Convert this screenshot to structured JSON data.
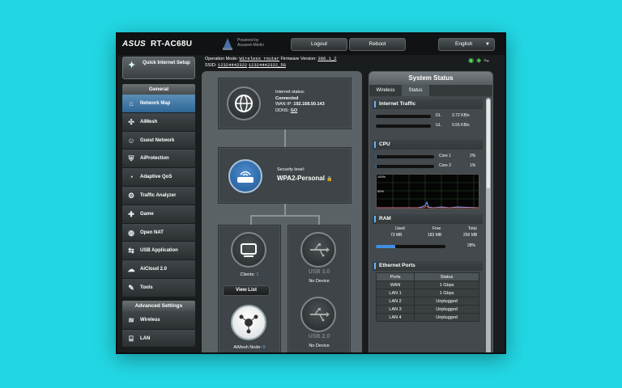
{
  "header": {
    "brand": "ASUS",
    "model": "RT-AC68U",
    "powered_by": "Powered by",
    "powered_name": "Asuswrt-Merlin",
    "logout": "Logout",
    "reboot": "Reboot",
    "language": "English"
  },
  "info": {
    "op_mode_label": "Operation Mode:",
    "op_mode_value": "Wireless router",
    "firmware_label": "Firmware Version:",
    "firmware_value": "386.1_2",
    "ssid_label": "SSID:",
    "ssid_1": "12324442322",
    "ssid_2": "12324442322_5G"
  },
  "sidebar": {
    "qis": "Quick Internet Setup",
    "general": "General",
    "items": [
      {
        "label": "Network Map",
        "icon": "network-map-icon"
      },
      {
        "label": "AiMesh",
        "icon": "aimesh-icon"
      },
      {
        "label": "Guest Network",
        "icon": "guest-network-icon"
      },
      {
        "label": "AiProtection",
        "icon": "aiprotection-icon"
      },
      {
        "label": "Adaptive QoS",
        "icon": "qos-icon"
      },
      {
        "label": "Traffic Analyzer",
        "icon": "traffic-analyzer-icon"
      },
      {
        "label": "Game",
        "icon": "game-icon"
      },
      {
        "label": "Open NAT",
        "icon": "open-nat-icon"
      },
      {
        "label": "USB Application",
        "icon": "usb-application-icon"
      },
      {
        "label": "AiCloud 2.0",
        "icon": "aicloud-icon"
      },
      {
        "label": "Tools",
        "icon": "tools-icon"
      }
    ],
    "advanced": "Advanced Settings",
    "advanced_items": [
      {
        "label": "Wireless",
        "icon": "wireless-icon"
      },
      {
        "label": "LAN",
        "icon": "lan-icon"
      }
    ]
  },
  "network_map": {
    "internet_status_label": "Internet status:",
    "internet_status_value": "Connected",
    "wan_ip_label": "WAN IP:",
    "wan_ip_value": "192.168.50.143",
    "ddns_label": "DDNS:",
    "ddns_value": "GO",
    "security_label": "Security level:",
    "security_value": "WPA2-Personal",
    "clients_label": "Clients:",
    "clients_value": "1",
    "view_list": "View List",
    "aimesh_label": "AiMesh Node:",
    "aimesh_value": "0",
    "usb1_label": "USB 3.0",
    "usb1_status": "No Device",
    "usb2_label": "USB 2.0",
    "usb2_status": "No Device"
  },
  "system_status": {
    "title": "System Status",
    "tabs": [
      "Wireless",
      "Status"
    ],
    "internet_traffic": "Internet Traffic",
    "dl_label": "DL",
    "dl_value": "3.72 KB/s",
    "ul_label": "UL",
    "ul_value": "0.55 KB/s",
    "cpu": "CPU",
    "core1_label": "Core 1",
    "core1_value": "2%",
    "core1_fraction": 0.02,
    "core2_label": "Core 2",
    "core2_value": "1%",
    "core2_fraction": 0.01,
    "graph_100": "100%",
    "graph_50": "50%",
    "ram": "RAM",
    "used_label": "Used",
    "used_value": "73 MB",
    "free_label": "Free",
    "free_value": "183 MB",
    "total_label": "Total",
    "total_value": "256 MB",
    "ram_percent": "28%",
    "ram_fraction": 0.28,
    "ethernet_ports": "Ethernet Ports",
    "eth_headers": [
      "Ports",
      "Status"
    ],
    "eth_rows": [
      [
        "WAN",
        "1 Gbps"
      ],
      [
        "LAN 1",
        "1 Gbps"
      ],
      [
        "LAN 2",
        "Unplugged"
      ],
      [
        "LAN 3",
        "Unplugged"
      ],
      [
        "LAN 4",
        "Unplugged"
      ]
    ]
  },
  "colors": {
    "background": "#22d7e3",
    "active_menu": "#3a76a8",
    "bar_fill": "#3d8fe6"
  }
}
